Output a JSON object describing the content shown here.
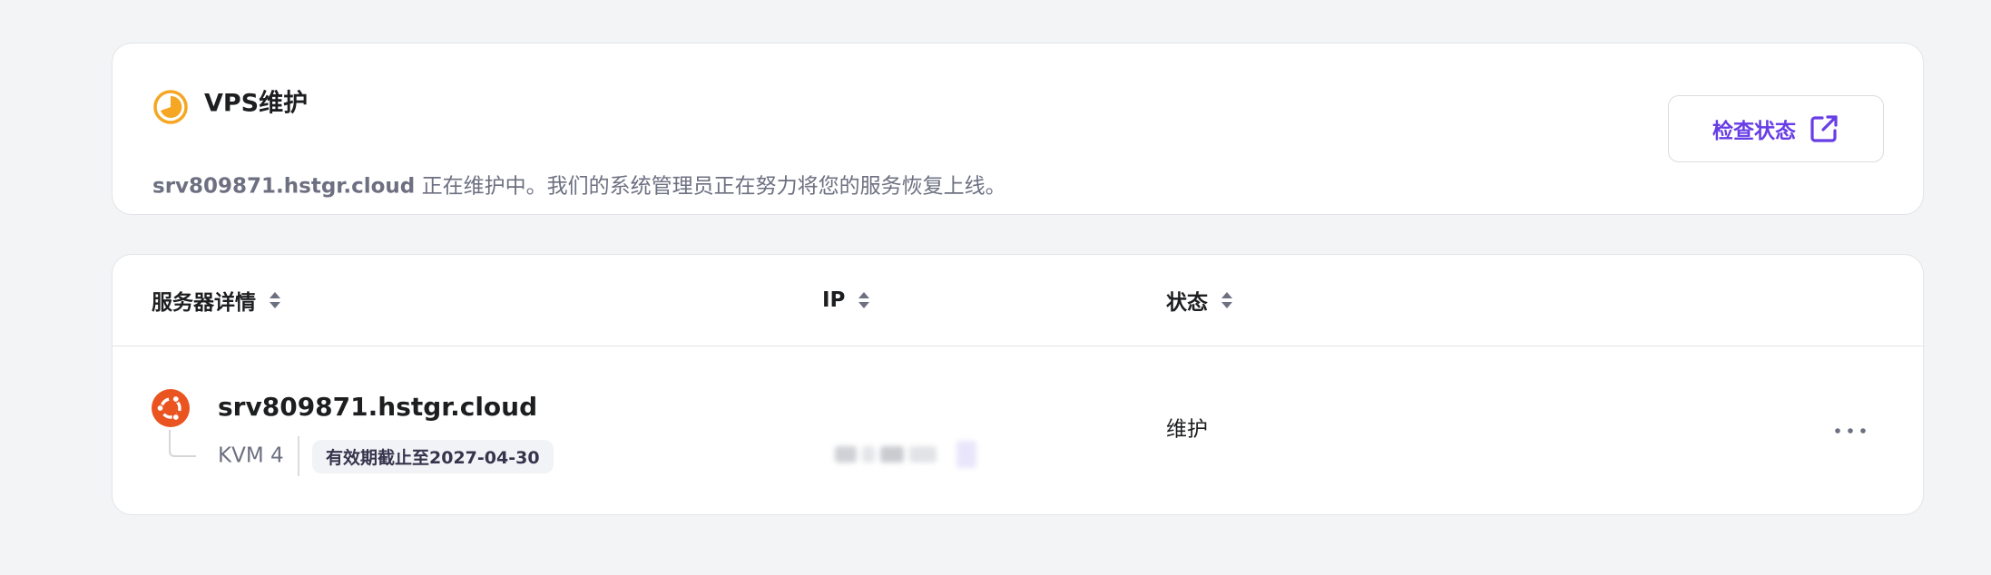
{
  "banner": {
    "title": "VPS维护",
    "hostname": "srv809871.hstgr.cloud",
    "message": " 正在维护中。我们的系统管理员正在努力将您的服务恢复上线。",
    "check_button_label": "检查状态",
    "icon": "maintenance-clock-icon",
    "accent_color": "#f5a623"
  },
  "table": {
    "columns": [
      {
        "label": "服务器详情",
        "sortable": true
      },
      {
        "label": "IP",
        "sortable": true
      },
      {
        "label": "状态",
        "sortable": true
      }
    ],
    "rows": [
      {
        "hostname": "srv809871.hstgr.cloud",
        "plan": "KVM 4",
        "expiry": "有效期截止至2027-04-30",
        "status": "维护",
        "os_icon": "ubuntu-icon",
        "actions_icon": "more-horizontal-icon"
      }
    ]
  },
  "colors": {
    "brand": "#673de6",
    "ubuntu": "#e95420",
    "text": "#1d1e20",
    "muted": "#6d7081"
  }
}
